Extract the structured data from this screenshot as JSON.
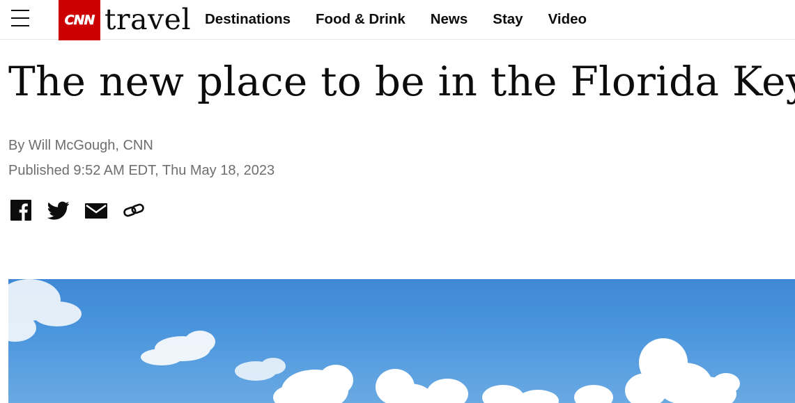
{
  "header": {
    "menu_icon": "hamburger-menu-icon",
    "logo_text": "CNN",
    "section_wordmark": "travel",
    "nav": [
      {
        "label": "Destinations"
      },
      {
        "label": "Food & Drink"
      },
      {
        "label": "News"
      },
      {
        "label": "Stay"
      },
      {
        "label": "Video"
      }
    ],
    "brand_color": "#cc0000"
  },
  "article": {
    "headline": "The new place to be in the Florida Keys",
    "byline_prefix": "By ",
    "author": "Will McGough, CNN",
    "published": "Published 9:52 AM EDT, Thu May 18, 2023",
    "share": [
      {
        "icon": "facebook-icon"
      },
      {
        "icon": "twitter-icon"
      },
      {
        "icon": "email-icon"
      },
      {
        "icon": "link-icon"
      }
    ],
    "hero_image": "blue-sky-with-clouds-photo"
  }
}
